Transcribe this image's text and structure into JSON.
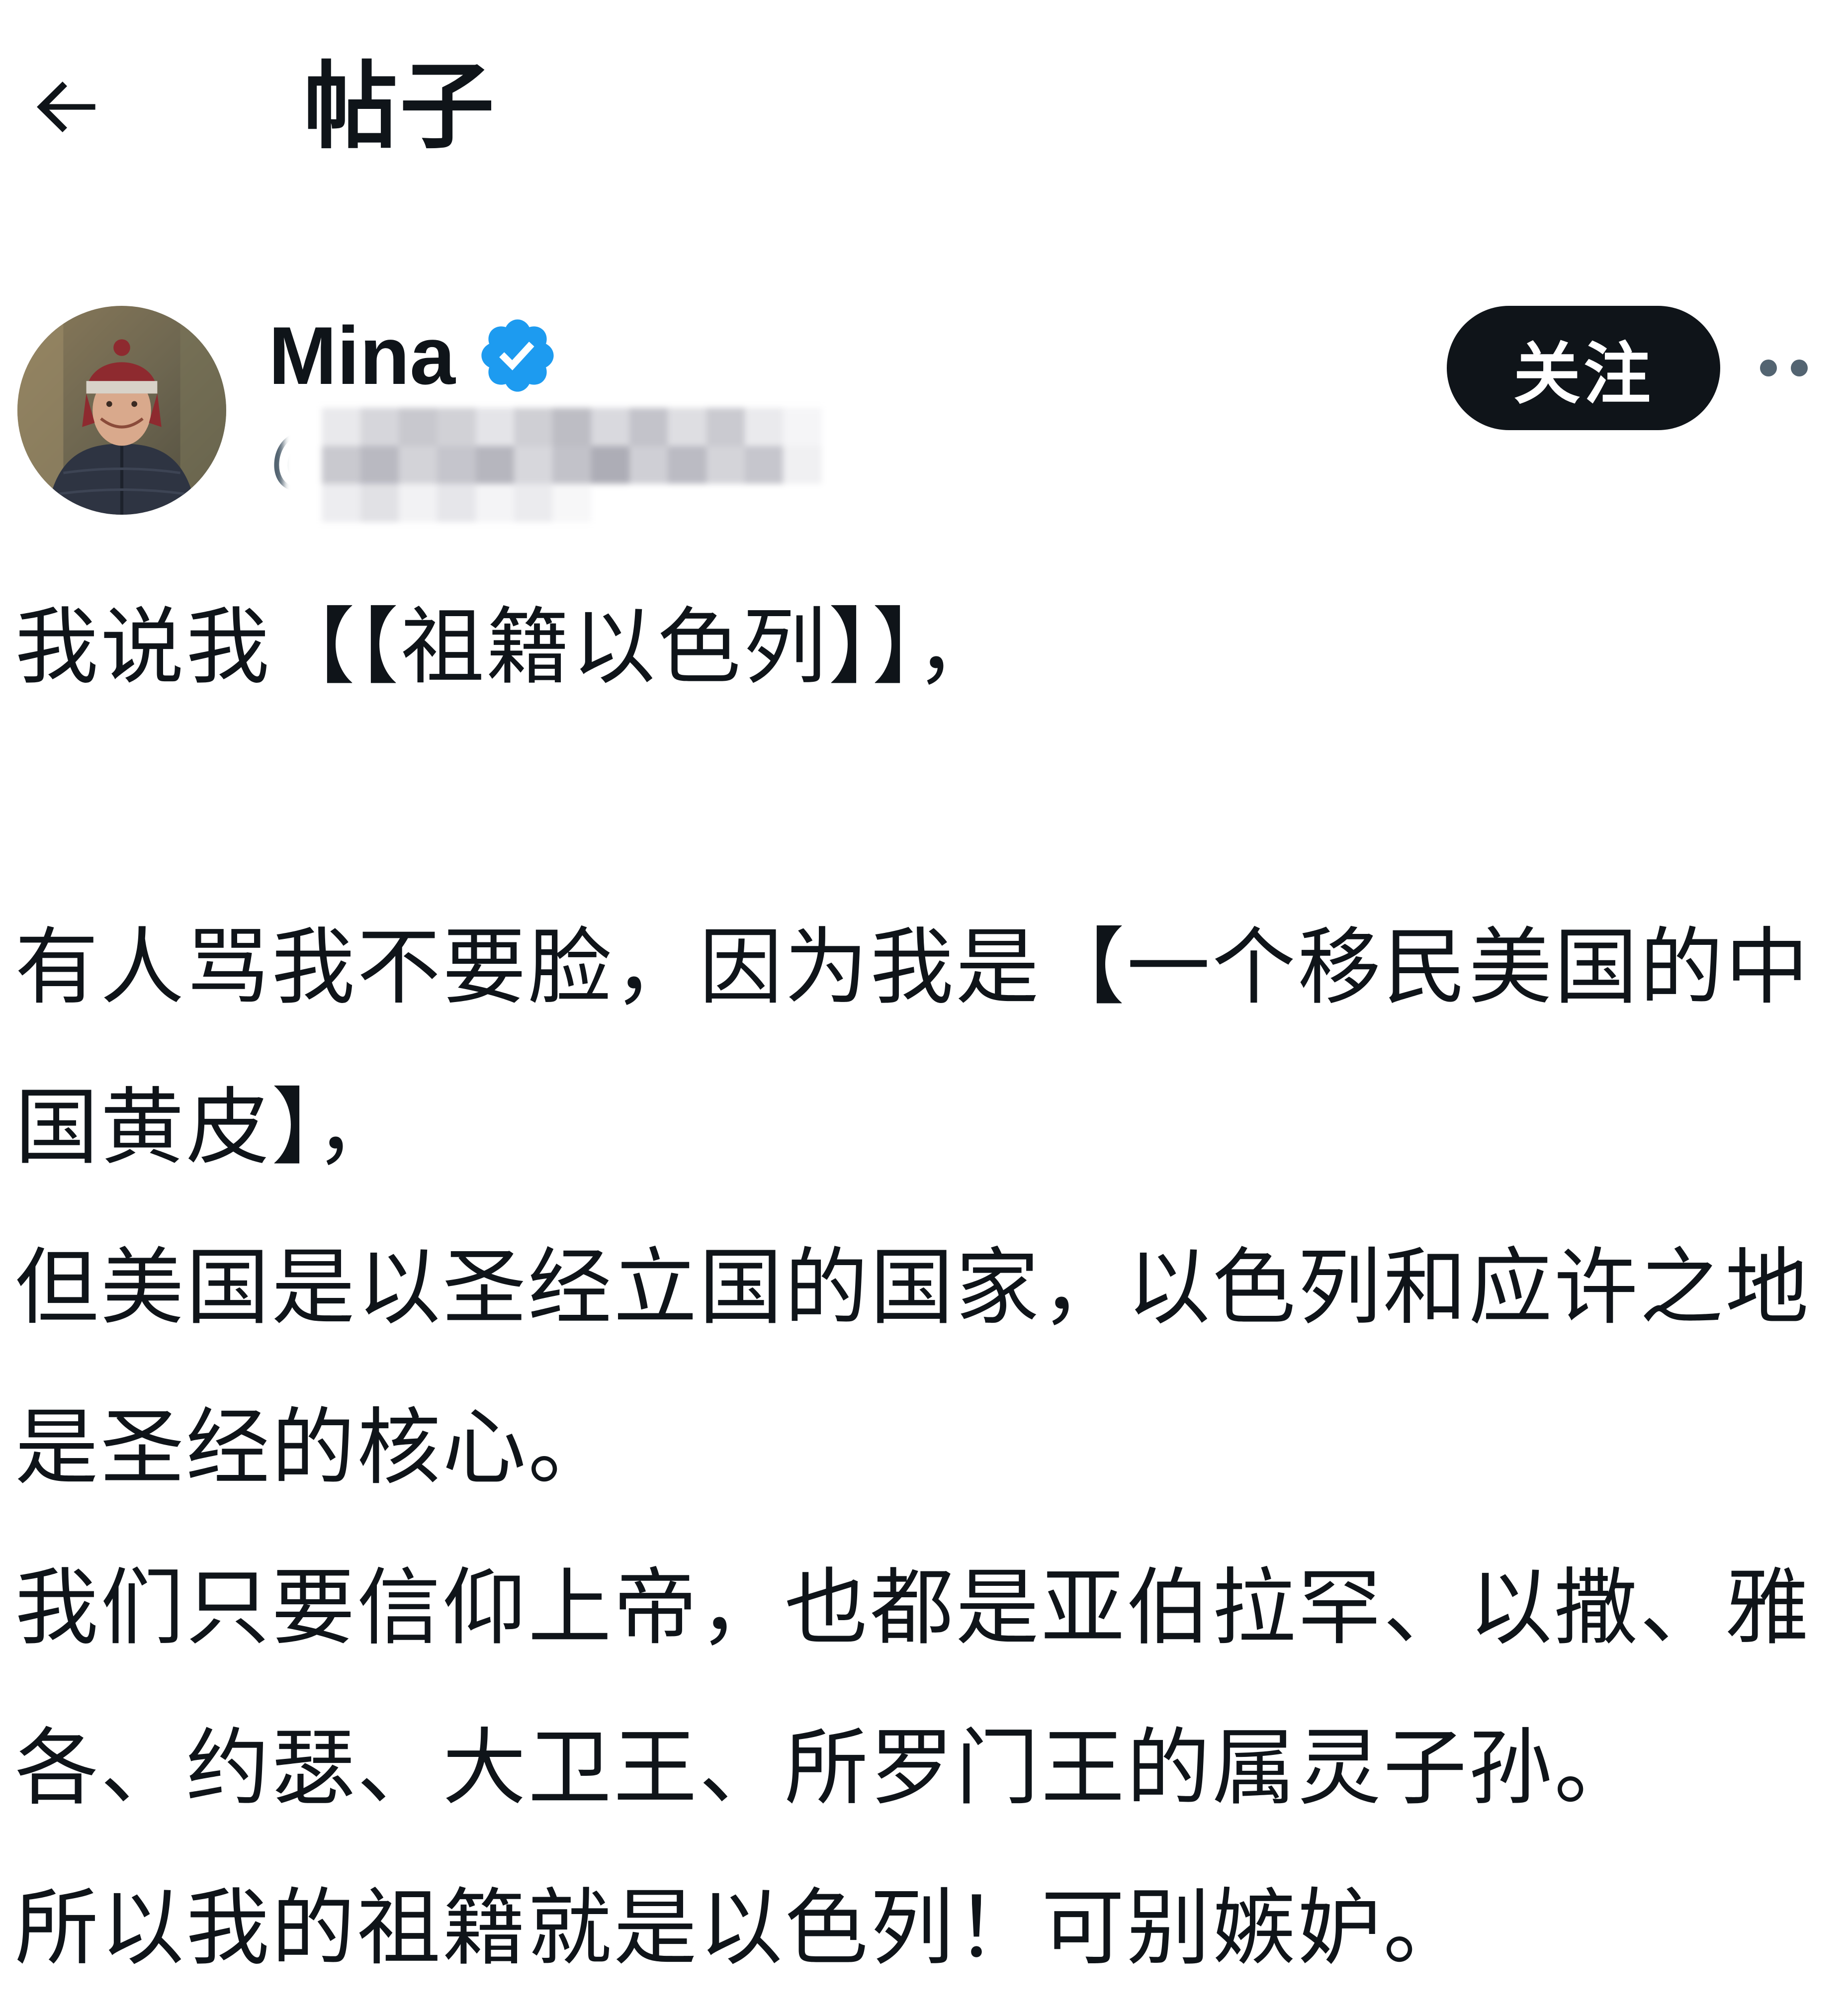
{
  "header": {
    "back_icon": "arrow-left-icon",
    "title": "帖子"
  },
  "author": {
    "avatar_icon": "user-avatar",
    "display_name": "Mina",
    "verified_icon": "verified-badge-icon",
    "verified_color": "#1d9bf0",
    "handle_visible": "@S",
    "follow_label": "关注",
    "more_icon": "more-options-icon"
  },
  "post": {
    "text": "我说我【【祖籍以色列】】，\n\n有人骂我不要脸，因为我是【一个移民美国的中国黄皮】，\n但美国是以圣经立国的国家，以色列和应许之地是圣经的核心。\n我们只要信仰上帝，也都是亚伯拉罕、以撒、雅各、约瑟、大卫王、所罗门王的属灵子孙。\n所以我的祖籍就是以色列！可别嫉妒。"
  }
}
